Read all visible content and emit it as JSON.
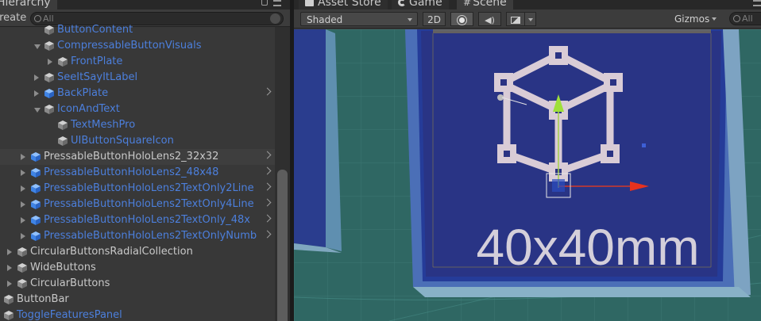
{
  "hierarchy": {
    "tab_label": "Hierarchy",
    "create_label": "Create",
    "search_placeholder": "All",
    "rows": [
      {
        "label": "ButtonContent",
        "indent": 3,
        "arrow": "none",
        "color": "blue"
      },
      {
        "label": "CompressableButtonVisuals",
        "indent": 3,
        "arrow": "down",
        "color": "blue"
      },
      {
        "label": "FrontPlate",
        "indent": 4,
        "arrow": "right",
        "color": "blue"
      },
      {
        "label": "SeeItSayItLabel",
        "indent": 3,
        "arrow": "right",
        "color": "blue"
      },
      {
        "label": "BackPlate",
        "indent": 3,
        "arrow": "right",
        "color": "blue",
        "chevron": true,
        "icon": "blue"
      },
      {
        "label": "IconAndText",
        "indent": 3,
        "arrow": "down",
        "color": "blue"
      },
      {
        "label": "TextMeshPro",
        "indent": 4,
        "arrow": "none",
        "color": "blue"
      },
      {
        "label": "UIButtonSquareIcon",
        "indent": 4,
        "arrow": "none",
        "color": "blue"
      },
      {
        "label": "PressableButtonHoloLens2_32x32",
        "indent": 2,
        "arrow": "right",
        "color": "white",
        "chevron": true,
        "icon": "blue",
        "selected": true
      },
      {
        "label": "PressableButtonHoloLens2_48x48",
        "indent": 2,
        "arrow": "right",
        "color": "blue",
        "chevron": true,
        "icon": "blue"
      },
      {
        "label": "PressableButtonHoloLens2TextOnly2Line",
        "indent": 2,
        "arrow": "right",
        "color": "blue",
        "chevron": true,
        "icon": "blue"
      },
      {
        "label": "PressableButtonHoloLens2TextOnly4Line",
        "indent": 2,
        "arrow": "right",
        "color": "blue",
        "chevron": true,
        "icon": "blue"
      },
      {
        "label": "PressableButtonHoloLens2TextOnly_48x",
        "indent": 2,
        "arrow": "right",
        "color": "blue",
        "chevron": true,
        "icon": "blue"
      },
      {
        "label": "PressableButtonHoloLens2TextOnlyNumb",
        "indent": 2,
        "arrow": "right",
        "color": "blue",
        "chevron": true,
        "icon": "blue"
      },
      {
        "label": "CircularButtonsRadialCollection",
        "indent": 1,
        "arrow": "right",
        "color": "white"
      },
      {
        "label": "WideButtons",
        "indent": 1,
        "arrow": "right",
        "color": "white"
      },
      {
        "label": "CircularButtons",
        "indent": 1,
        "arrow": "right",
        "color": "white"
      },
      {
        "label": "ButtonBar",
        "indent": 0,
        "arrow": "none",
        "color": "white"
      },
      {
        "label": "ToggleFeaturesPanel",
        "indent": 0,
        "arrow": "none",
        "color": "blue"
      }
    ]
  },
  "scene": {
    "tabs": [
      "Asset Store",
      "Game",
      "Scene"
    ],
    "shading_mode": "Shaded",
    "mode_2d": "2D",
    "gizmos_label": "Gizmos",
    "search_placeholder": "All",
    "plate_text": "40x40mm"
  }
}
